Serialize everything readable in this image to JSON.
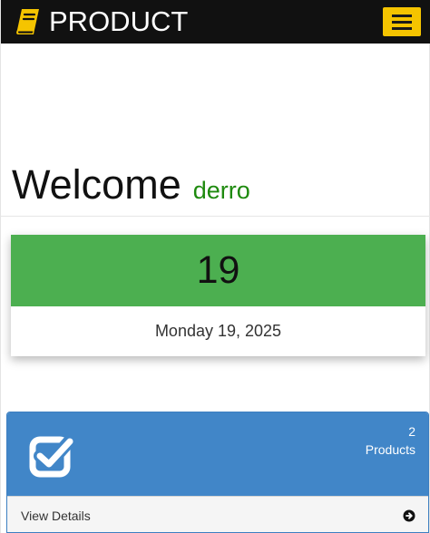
{
  "navbar": {
    "brand_text": "PRODUCT",
    "brand_icon": "book-icon",
    "menu_icon": "hamburger-icon",
    "bg_color": "#111111",
    "menu_color": "#f5c400"
  },
  "welcome": {
    "title": "Welcome",
    "username": "derro",
    "username_color": "#1e8a0e"
  },
  "date_card": {
    "day": "19",
    "date_text": "Monday 19, 2025",
    "accent_color": "#4caf50"
  },
  "products_panel": {
    "count": "2",
    "label": "Products",
    "icon": "check-square-icon",
    "footer_label": "View Details",
    "footer_icon": "arrow-circle-right-icon",
    "color": "#4186c8"
  }
}
